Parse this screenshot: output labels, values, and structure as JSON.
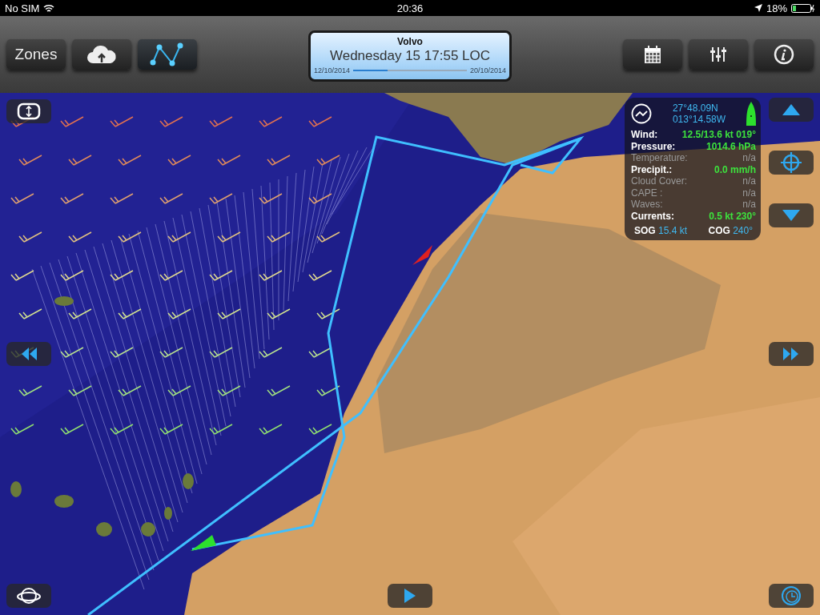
{
  "status_bar": {
    "carrier": "No SIM",
    "time": "20:36",
    "battery": "18%"
  },
  "toolbar": {
    "left_buttons": [
      {
        "kind": "text",
        "label": "Zones"
      },
      {
        "kind": "cloud"
      },
      {
        "kind": "route",
        "selected": true
      }
    ],
    "right_buttons": [
      {
        "kind": "calendar"
      },
      {
        "kind": "sliders"
      },
      {
        "kind": "info"
      }
    ]
  },
  "timeline": {
    "title": "Volvo",
    "time": "Wednesday 15 17:55 LOC",
    "start": "12/10/2014",
    "end": "20/10/2014",
    "level": 0.3
  },
  "info_panel": {
    "latitude": "27°48.09N",
    "longitude": "013°14.58W",
    "rows": [
      {
        "label": "Wind:",
        "value": "12.5/13.6 kt 019°",
        "available": true
      },
      {
        "label": "Pressure:",
        "value": "1014.6 hPa",
        "available": true
      },
      {
        "label": "Temperature:",
        "value": "n/a",
        "available": false
      },
      {
        "label": "Precipit.:",
        "value": "0.0 mm/h",
        "available": true
      },
      {
        "label": "Cloud Cover:",
        "value": "n/a",
        "available": false
      },
      {
        "label": "CAPE :",
        "value": "n/a",
        "available": false
      },
      {
        "label": "Waves:",
        "value": "n/a",
        "available": false
      },
      {
        "label": "Currents:",
        "value": "0.5 kt 230°",
        "available": true
      }
    ],
    "sog_label": "SOG",
    "sog": "15.4 kt",
    "cog_label": "COG",
    "cog": "240°"
  }
}
